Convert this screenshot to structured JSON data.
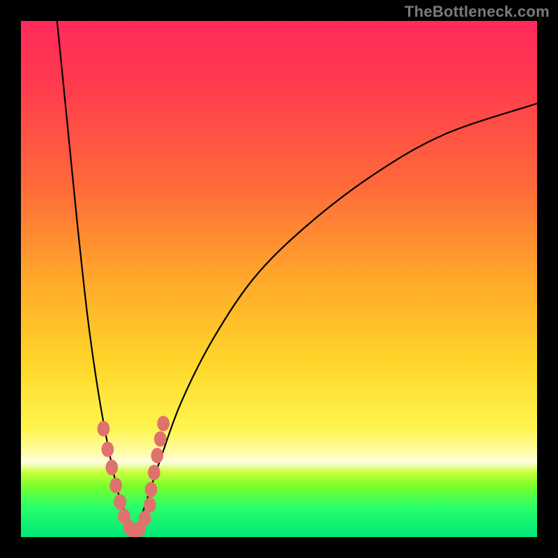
{
  "watermark": {
    "text": "TheBottleneck.com"
  },
  "chart_data": {
    "type": "line",
    "title": "",
    "xlabel": "",
    "ylabel": "",
    "xlim": [
      0,
      100
    ],
    "ylim": [
      0,
      100
    ],
    "grid": false,
    "background_gradient": {
      "direction": "vertical",
      "stops": [
        {
          "pos": 0.0,
          "color": "#ff2a5b"
        },
        {
          "pos": 0.5,
          "color": "#ffa82a"
        },
        {
          "pos": 0.8,
          "color": "#fff54f"
        },
        {
          "pos": 0.86,
          "color": "#fffde0"
        },
        {
          "pos": 0.9,
          "color": "#7cff2a"
        },
        {
          "pos": 1.0,
          "color": "#00e879"
        }
      ]
    },
    "series": [
      {
        "name": "left-branch",
        "stroke": "#000000",
        "values": [
          {
            "x": 7,
            "y": 100
          },
          {
            "x": 9,
            "y": 80
          },
          {
            "x": 11,
            "y": 60
          },
          {
            "x": 13,
            "y": 42
          },
          {
            "x": 15,
            "y": 28
          },
          {
            "x": 17,
            "y": 17
          },
          {
            "x": 19,
            "y": 8
          },
          {
            "x": 21,
            "y": 3
          },
          {
            "x": 22,
            "y": 0
          }
        ]
      },
      {
        "name": "right-branch",
        "stroke": "#000000",
        "values": [
          {
            "x": 22,
            "y": 0
          },
          {
            "x": 24,
            "y": 6
          },
          {
            "x": 27,
            "y": 15
          },
          {
            "x": 31,
            "y": 26
          },
          {
            "x": 37,
            "y": 38
          },
          {
            "x": 45,
            "y": 50
          },
          {
            "x": 55,
            "y": 60
          },
          {
            "x": 68,
            "y": 70
          },
          {
            "x": 82,
            "y": 78
          },
          {
            "x": 100,
            "y": 84
          }
        ]
      }
    ],
    "scatter": {
      "name": "near-minimum-points",
      "color": "#e0726d",
      "radius_pct": 1.2,
      "points": [
        {
          "x": 16.0,
          "y": 21.0
        },
        {
          "x": 16.8,
          "y": 17.0
        },
        {
          "x": 17.6,
          "y": 13.5
        },
        {
          "x": 18.4,
          "y": 10.0
        },
        {
          "x": 19.2,
          "y": 6.8
        },
        {
          "x": 20.0,
          "y": 4.0
        },
        {
          "x": 21.0,
          "y": 1.8
        },
        {
          "x": 22.0,
          "y": 0.6
        },
        {
          "x": 23.0,
          "y": 1.6
        },
        {
          "x": 24.0,
          "y": 3.6
        },
        {
          "x": 25.0,
          "y": 6.2
        },
        {
          "x": 25.2,
          "y": 9.2
        },
        {
          "x": 25.8,
          "y": 12.5
        },
        {
          "x": 26.4,
          "y": 15.8
        },
        {
          "x": 27.0,
          "y": 19.0
        },
        {
          "x": 27.6,
          "y": 22.0
        }
      ]
    }
  }
}
